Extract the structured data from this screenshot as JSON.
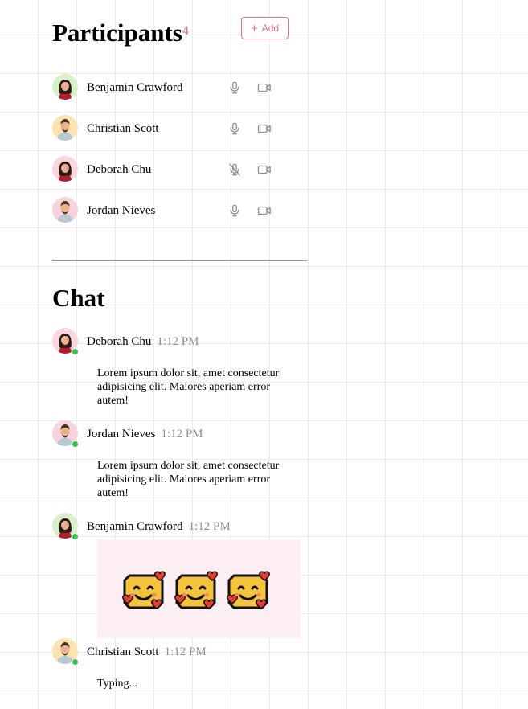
{
  "participants": {
    "title": "Participants",
    "count": "4",
    "add_label": "Add",
    "items": [
      {
        "name": "Benjamin Crawford",
        "mic": "microphone-icon",
        "camera": "video-camera-icon",
        "avatar_bg": "#d9f0c9"
      },
      {
        "name": "Christian Scott",
        "mic": "microphone-icon",
        "camera": "video-camera-icon",
        "avatar_bg": "#fde3b0"
      },
      {
        "name": "Deborah Chu",
        "mic": "microphone-muted-icon",
        "camera": "video-camera-icon",
        "avatar_bg": "#fbd6df"
      },
      {
        "name": "Jordan Nieves",
        "mic": "microphone-icon",
        "camera": "video-camera-icon",
        "avatar_bg": "#f9d3dc"
      }
    ]
  },
  "chat": {
    "title": "Chat",
    "messages": [
      {
        "name": "Deborah Chu",
        "time": "1:12 PM",
        "text": "Lorem ipsum dolor sit, amet consectetur adipisicing elit. Maiores aperiam error autem!"
      },
      {
        "name": "Jordan Nieves",
        "time": "1:12 PM",
        "text": "Lorem ipsum dolor sit, amet consectetur adipisicing elit. Maiores aperiam error autem!"
      },
      {
        "name": "Benjamin Crawford",
        "time": "1:12 PM",
        "stickers": [
          "smiling-face-with-hearts-sticker",
          "smiling-face-with-hearts-sticker",
          "smiling-face-with-hearts-sticker"
        ]
      },
      {
        "name": "Christian Scott",
        "time": "1:12 PM",
        "text": "Typing..."
      }
    ]
  },
  "colors": {
    "accent": "#ea6d8f",
    "online": "#2bc653",
    "icon": "#8b8f99",
    "sticker_bg": "#fdeff2",
    "timestamp": "#8f8f8f"
  }
}
